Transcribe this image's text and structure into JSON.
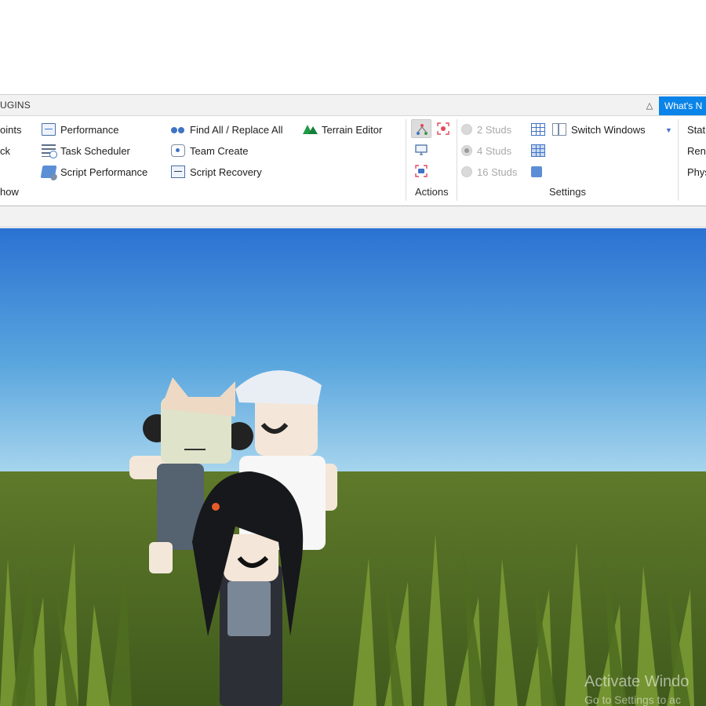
{
  "tabbar": {
    "tab_label": "UGINS",
    "whats_new": "What's N"
  },
  "ribbon": {
    "left_clip": [
      "oints",
      "ck",
      "how"
    ],
    "col1": [
      "Performance",
      "Task Scheduler",
      "Script Performance"
    ],
    "col2": [
      "Find All / Replace All",
      "Team Create",
      "Script Recovery"
    ],
    "col3": [
      "Terrain Editor"
    ],
    "actions_label": "Actions",
    "studs": [
      "2 Studs",
      "4 Studs",
      "16 Studs"
    ],
    "switch_windows": "Switch Windows",
    "settings_label": "Settings",
    "right_clip": [
      "Stat",
      "Rend",
      "Phys"
    ]
  },
  "watermark": {
    "title": "Activate Windo",
    "subtitle": "Go to Settings to ac"
  },
  "colors": {
    "accent": "#0a84e8",
    "terrain_green": "#1f9a45",
    "sky_top": "#2f78d4",
    "grass": "#5a7a24"
  }
}
